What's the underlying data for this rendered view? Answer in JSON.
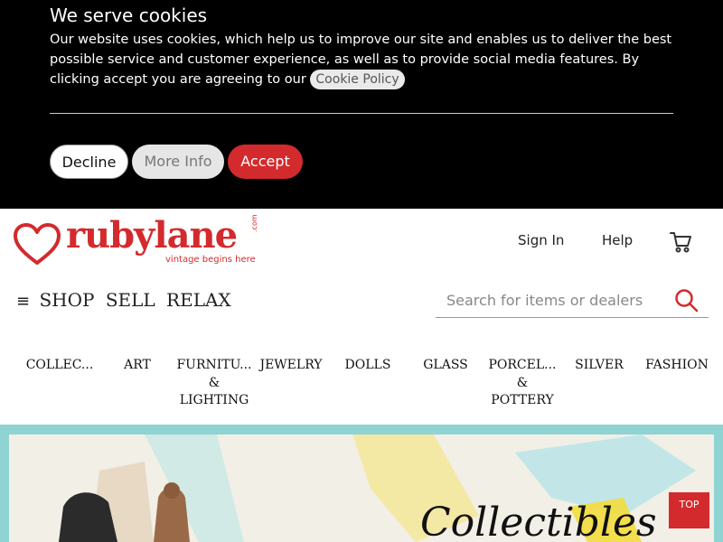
{
  "cookie_banner": {
    "title": "We serve cookies",
    "text": "Our website uses cookies, which help us to improve our site and enables us to deliver the best possible service and customer experience, as well as to provide social media features. By clicking accept you are agreeing to our",
    "policy_link": "Cookie Policy",
    "decline_label": "Decline",
    "more_info_label": "More Info",
    "accept_label": "Accept"
  },
  "header": {
    "logo_word": "rubylane",
    "logo_tagline": "vintage begins here",
    "logo_com": ".com",
    "sign_in": "Sign In",
    "help": "Help"
  },
  "shopline": {
    "menu_glyph": "≡",
    "shop": "SHOP",
    "sell": "SELL",
    "relax": "RELAX"
  },
  "search": {
    "placeholder": "Search for items or dealers"
  },
  "categories": [
    {
      "label": "COLLEC..."
    },
    {
      "label": "ART"
    },
    {
      "label": "FURNITU...\n&\nLIGHTING"
    },
    {
      "label": "JEWELRY"
    },
    {
      "label": "DOLLS"
    },
    {
      "label": "GLASS"
    },
    {
      "label": "PORCEL...\n&\nPOTTERY"
    },
    {
      "label": "SILVER"
    },
    {
      "label": "FASHION"
    }
  ],
  "hero": {
    "script_text": "Collectibles"
  },
  "top_button": "TOP",
  "colors": {
    "brand_red": "#d32a2d",
    "banner_bg": "#000000",
    "hero_frame": "#8fd3d2"
  }
}
